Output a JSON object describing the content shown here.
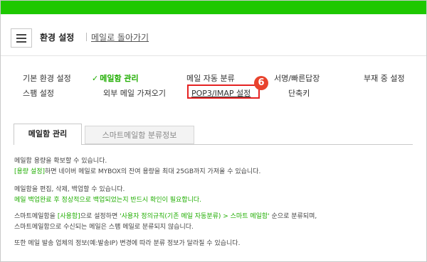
{
  "header": {
    "title": "환경 설정",
    "back_link": "메일로 돌아가기"
  },
  "nav": {
    "row1": [
      {
        "label": "기본 환경 설정"
      },
      {
        "label": "메일함 관리",
        "active": true
      },
      {
        "label": "메일 자동 분류"
      },
      {
        "label": "서명/빠른답장"
      },
      {
        "label": "부재 중 설정"
      }
    ],
    "row2": [
      {
        "label": "스팸 설정"
      },
      {
        "label": "외부 메일 가져오기"
      },
      {
        "label": "POP3/IMAP 설정",
        "highlighted": true
      },
      {
        "label": "단축키"
      }
    ],
    "check_mark": "✓",
    "step_badge": "6"
  },
  "tabs": {
    "active": "메일함 관리",
    "inactive": "스마트메일함 분류정보"
  },
  "content": {
    "p1_line1": "메일함 용량을 확보할 수 있습니다.",
    "p1_line2_link": "[용량 설정]",
    "p1_line2_rest": "하면 네이버 메일로 MYBOX의 잔여 용량을 최대 25GB까지 가져올 수 있습니다.",
    "p2_line1": "메일함을 편집, 삭제, 백업할 수 있습니다.",
    "p2_line2": "메일 백업완료 후 정상적으로 백업되었는지 반드시 확인이 필요합니다.",
    "p3_line1_a": "스마트메일함을 ",
    "p3_line1_b": "[사용함]",
    "p3_line1_c": "으로 설정하면 ",
    "p3_line1_d": "'사용자 정의규칙(기존 메일 자동분류) > 스마트 메일함'",
    "p3_line1_e": " 순으로 분류되며,",
    "p3_line2": "스마트메일함으로 수신되는 메일은 스팸 메일로 분류되지 않습니다.",
    "p4_line1": "또한 메일 발송 업체의 정보(예:발송IP) 변경에 따라 분류 정보가 달라질 수 있습니다."
  },
  "colors": {
    "brand_green": "#1ec800",
    "accent_green": "#1fad00",
    "highlight_red": "#e52222",
    "badge_red": "#e8432d"
  }
}
